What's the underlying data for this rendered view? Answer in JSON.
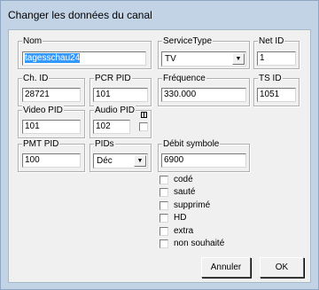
{
  "window": {
    "title": "Changer les données du canal"
  },
  "groups": {
    "nom": {
      "label": "Nom",
      "value": "tagesschau24"
    },
    "service_type": {
      "label": "ServiceType",
      "value": "TV"
    },
    "net_id": {
      "label": "Net ID",
      "value": "1"
    },
    "ch_id": {
      "label": "Ch. ID",
      "value": "28721"
    },
    "pcr_pid": {
      "label": "PCR PID",
      "value": "101"
    },
    "frequence": {
      "label": "Fréquence",
      "value": "330.000"
    },
    "ts_id": {
      "label": "TS ID",
      "value": "1051"
    },
    "video_pid": {
      "label": "Video PID",
      "value": "101"
    },
    "audio_pid": {
      "label": "Audio PID",
      "value": "102"
    },
    "pmt_pid": {
      "label": "PMT PID",
      "value": "100"
    },
    "pids": {
      "label": "PIDs",
      "value": "Déc"
    },
    "debit_symbole": {
      "label": "Débit symbole",
      "value": "6900"
    }
  },
  "checkboxes": [
    {
      "label": "codé",
      "checked": false
    },
    {
      "label": "sauté",
      "checked": false
    },
    {
      "label": "supprimé",
      "checked": false
    },
    {
      "label": "HD",
      "checked": false
    },
    {
      "label": "extra",
      "checked": false
    },
    {
      "label": "non souhaité",
      "checked": false
    }
  ],
  "buttons": {
    "cancel": "Annuler",
    "ok": "OK"
  },
  "icons": {
    "combo_arrow": "chevron-down-icon",
    "audio_toggle": "audio-channel-icon"
  }
}
